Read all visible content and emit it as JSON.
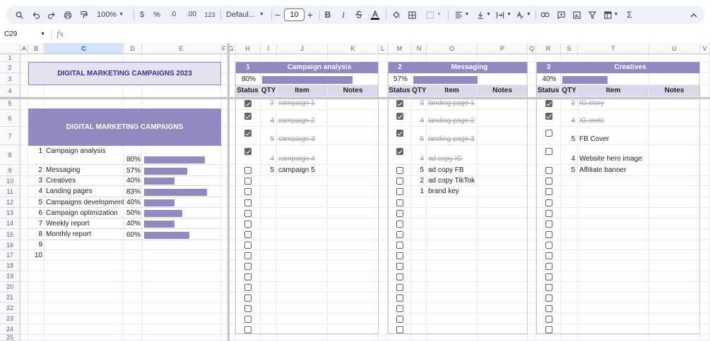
{
  "toolbar": {
    "zoom": "100%",
    "currency": "$",
    "percent": "%",
    "dec_decrease": ".0",
    "dec_increase": ".00",
    "number_format": "123",
    "font": "Defaul...",
    "font_size": "10",
    "bold": "B",
    "italic": "I",
    "sum": "Σ"
  },
  "formula_bar": {
    "name_box": "C29"
  },
  "columns": [
    "A",
    "B",
    "C",
    "D",
    "E",
    "F",
    "G",
    "H",
    "I",
    "J",
    "K",
    "L",
    "M",
    "N",
    "O",
    "P",
    "Q",
    "R",
    "S",
    "T",
    "U",
    "V"
  ],
  "rows": [
    "1",
    "2",
    "3",
    "4",
    "5",
    "6",
    "7",
    "8",
    "9",
    "10",
    "11",
    "12",
    "13",
    "14",
    "15",
    "16",
    "17",
    "18",
    "19",
    "20",
    "21",
    "22",
    "23",
    "24",
    "25"
  ],
  "left": {
    "title": "DIGITAL MARKETING CAMPAIGNS 2023",
    "summary_header": "DIGITAL MARKETING CAMPAIGNS",
    "items": [
      {
        "n": "1",
        "name": "Campaign analysis",
        "pct": "80%",
        "value": 0.8
      },
      {
        "n": "2",
        "name": "Messaging",
        "pct": "57%",
        "value": 0.57
      },
      {
        "n": "3",
        "name": "Creatives",
        "pct": "40%",
        "value": 0.4
      },
      {
        "n": "4",
        "name": "Landing pages",
        "pct": "83%",
        "value": 0.83
      },
      {
        "n": "5",
        "name": "Campaigns development",
        "pct": "40%",
        "value": 0.4
      },
      {
        "n": "6",
        "name": "Campaign optimization",
        "pct": "50%",
        "value": 0.5
      },
      {
        "n": "7",
        "name": "Weekly report",
        "pct": "40%",
        "value": 0.4
      },
      {
        "n": "8",
        "name": "Monthly report",
        "pct": "60%",
        "value": 0.6
      },
      {
        "n": "9",
        "name": "",
        "pct": "",
        "value": 0
      },
      {
        "n": "10",
        "name": "",
        "pct": "",
        "value": 0
      }
    ]
  },
  "sections": [
    {
      "num": "1",
      "title": "Campaign analysis",
      "pct": "80%",
      "value": 0.8,
      "headers": {
        "status": "Status",
        "qty": "QTY",
        "item": "Item",
        "notes": "Notes"
      },
      "tasks": [
        {
          "done": true,
          "qty": "2",
          "item": "campaign 1"
        },
        {
          "done": true,
          "qty": "4",
          "item": "campaign 2"
        },
        {
          "done": true,
          "qty": "5",
          "item": "campaign 3"
        },
        {
          "done": true,
          "qty": "4",
          "item": "campaign 4"
        },
        {
          "done": false,
          "qty": "5",
          "item": "campaign 5"
        }
      ]
    },
    {
      "num": "2",
      "title": "Messaging",
      "pct": "57%",
      "value": 0.57,
      "headers": {
        "status": "Status",
        "qty": "QTY",
        "item": "Item",
        "notes": "Notes"
      },
      "tasks": [
        {
          "done": true,
          "qty": "2",
          "item": "landing page 1"
        },
        {
          "done": true,
          "qty": "4",
          "item": "landing page 2"
        },
        {
          "done": true,
          "qty": "5",
          "item": "landing page 3"
        },
        {
          "done": true,
          "qty": "4",
          "item": "ad copy IG"
        },
        {
          "done": false,
          "qty": "5",
          "item": "ad copy FB"
        },
        {
          "done": false,
          "qty": "2",
          "item": "ad copy TikTok"
        },
        {
          "done": false,
          "qty": "1",
          "item": "brand key"
        }
      ]
    },
    {
      "num": "3",
      "title": "Creatives",
      "pct": "40%",
      "value": 0.4,
      "headers": {
        "status": "Status",
        "qty": "QTY",
        "item": "Item",
        "notes": "Notes"
      },
      "tasks": [
        {
          "done": true,
          "qty": "2",
          "item": "IG story"
        },
        {
          "done": true,
          "qty": "4",
          "item": "IG reels"
        },
        {
          "done": false,
          "qty": "5",
          "item": "FB Cover"
        },
        {
          "done": false,
          "qty": "4",
          "item": "Website hero image"
        },
        {
          "done": false,
          "qty": "5",
          "item": "Affiliate banner"
        }
      ]
    }
  ],
  "colors": {
    "accent": "#9488c0",
    "accent_light": "#dcd8ec",
    "title_bg": "#e4e1f0"
  }
}
